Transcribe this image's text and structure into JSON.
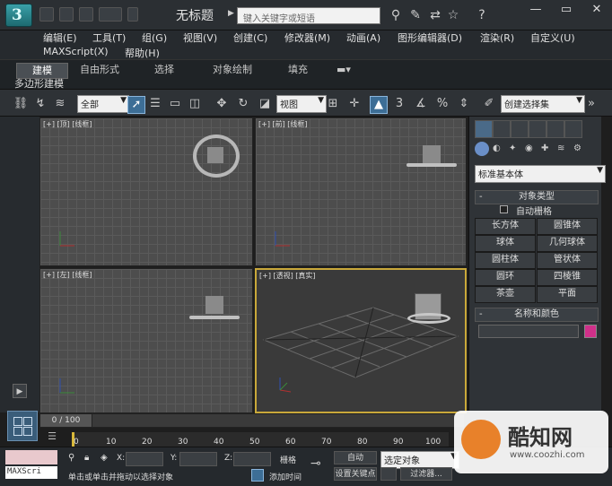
{
  "window": {
    "title": "无标题",
    "search_placeholder": "键入关键字或短语",
    "min": "—",
    "max": "▭",
    "close": "✕"
  },
  "menus": [
    "编辑(E)",
    "工具(T)",
    "组(G)",
    "视图(V)",
    "创建(C)",
    "修改器(M)",
    "动画(A)",
    "图形编辑器(D)",
    "渲染(R)",
    "自定义(U)",
    "MAXScript(X)",
    "帮助(H)"
  ],
  "ribbon": {
    "tabs": [
      "建模",
      "自由形式",
      "选择",
      "对象绘制",
      "填充"
    ],
    "active": "建模",
    "subtab": "多边形建模"
  },
  "toolbar": {
    "filter": "全部",
    "ref_coord": "视图",
    "named_sel": "创建选择集"
  },
  "viewports": [
    {
      "label": "[+] [顶] [线框]"
    },
    {
      "label": "[+] [前] [线框]"
    },
    {
      "label": "[+] [左] [线框]"
    },
    {
      "label": "[+] [透视] [真实]"
    }
  ],
  "command_panel": {
    "category": "标准基本体",
    "object_type_title": "对象类型",
    "autogrid": "自动栅格",
    "buttons": [
      "长方体",
      "圆锥体",
      "球体",
      "几何球体",
      "圆柱体",
      "管状体",
      "圆环",
      "四棱锥",
      "茶壶",
      "平面"
    ],
    "name_color_title": "名称和颜色"
  },
  "timeline": {
    "frame": "0 / 100",
    "ticks": [
      "0",
      "10",
      "20",
      "30",
      "40",
      "50",
      "60",
      "70",
      "80",
      "90",
      "100"
    ]
  },
  "status": {
    "maxscript": "MAXScri",
    "x_label": "X:",
    "y_label": "Y:",
    "z_label": "Z:",
    "grid": "栅格",
    "prompt": "单击或单击并拖动以选择对象",
    "add_time_tag": "添加时间",
    "auto": "自动",
    "selected": "选定对象",
    "set_key": "设置关键点",
    "filters": "过滤器..."
  },
  "watermark": {
    "brand": "酷知网",
    "url": "www.coozhi.com"
  },
  "colors": {
    "accent": "#3d6e96",
    "active_viewport": "#c9a83a",
    "object_color": "#d0308a"
  }
}
